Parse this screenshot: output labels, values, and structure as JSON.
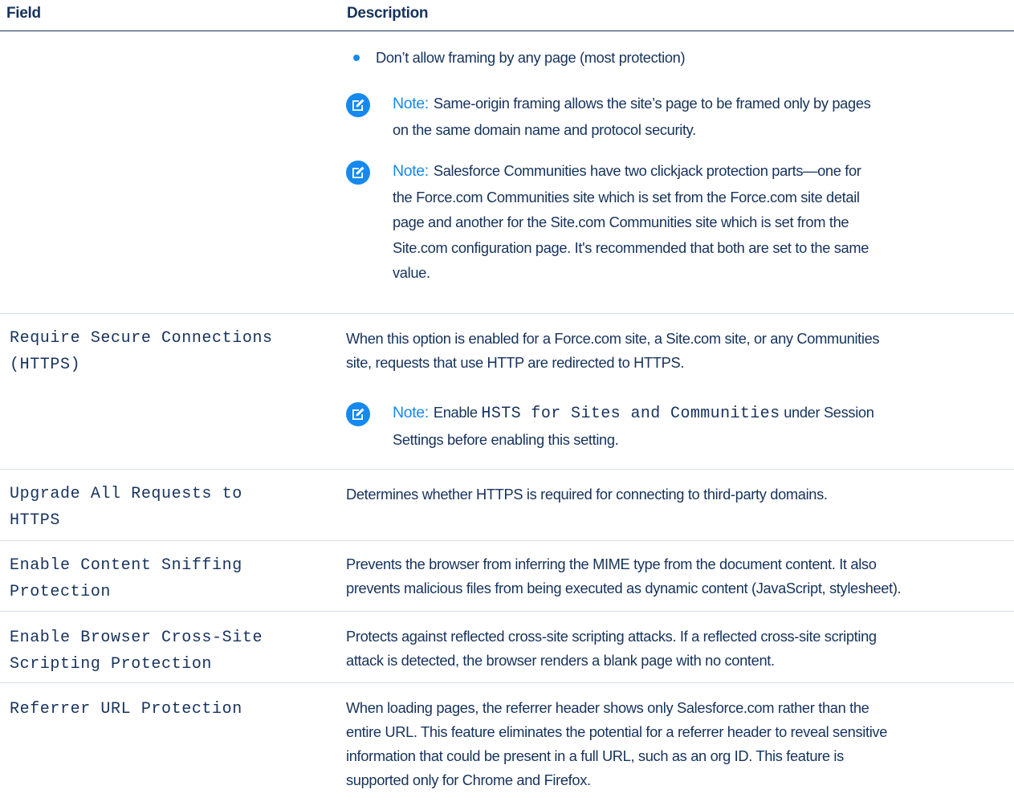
{
  "header": {
    "field_label": "Field",
    "description_label": "Description"
  },
  "row0": {
    "bullet": "Don’t allow framing by any page (most protection)",
    "note1": {
      "label": "Note:",
      "line1": "Same-origin framing allows the site’s page to be framed only by pages",
      "line2": "on the same domain name and protocol security."
    },
    "note2": {
      "label": "Note:",
      "line1": "Salesforce Communities have two clickjack protection parts—one for",
      "line2": "the Force.com Communities site which is set from the Force.com site detail",
      "line3": "page and another for the Site.com Communities site which is set from the",
      "line4": "Site.com configuration page. It's recommended that both are set to the same",
      "line5": "value."
    }
  },
  "row1": {
    "field_line1": "Require Secure Connections",
    "field_line2": "(HTTPS)",
    "desc_line1": "When this option is enabled for a Force.com site, a Site.com site, or any Communities",
    "desc_line2": "site, requests that use HTTP are redirected to HTTPS.",
    "note": {
      "label": "Note:",
      "pre": "Enable",
      "code": "HSTS for Sites and Communities",
      "post": "under Session",
      "line2": "Settings before enabling this setting."
    }
  },
  "row2": {
    "field_line1": "Upgrade All Requests to",
    "field_line2": "HTTPS",
    "desc_line1": "Determines whether HTTPS is required for connecting to third-party domains."
  },
  "row3": {
    "field_line1": "Enable Content Sniffing",
    "field_line2": "Protection",
    "desc_line1": "Prevents the browser from inferring the MIME type from the document content. It also",
    "desc_line2": "prevents malicious files from being executed as dynamic content (JavaScript, stylesheet)."
  },
  "row4": {
    "field_line1": "Enable Browser Cross-Site",
    "field_line2": "Scripting Protection",
    "desc_line1": "Protects against reflected cross-site scripting attacks. If a reflected cross-site scripting",
    "desc_line2": "attack is detected, the browser renders a blank page with no content."
  },
  "row5": {
    "field_line1": "Referrer URL Protection",
    "desc_line1": "When loading pages, the referrer header shows only Salesforce.com rather than the",
    "desc_line2": "entire URL. This feature eliminates the potential for a referrer header to reveal sensitive",
    "desc_line3": "information that could be present in a full URL, such as an org ID. This feature is",
    "desc_line4": "supported only for Chrome and Firefox."
  },
  "colors": {
    "text": "#16325c",
    "accent": "#1589ee",
    "divider": "#d8dde6"
  },
  "icons": {
    "note": "note-edit-icon",
    "bullet": "bullet-dot"
  }
}
